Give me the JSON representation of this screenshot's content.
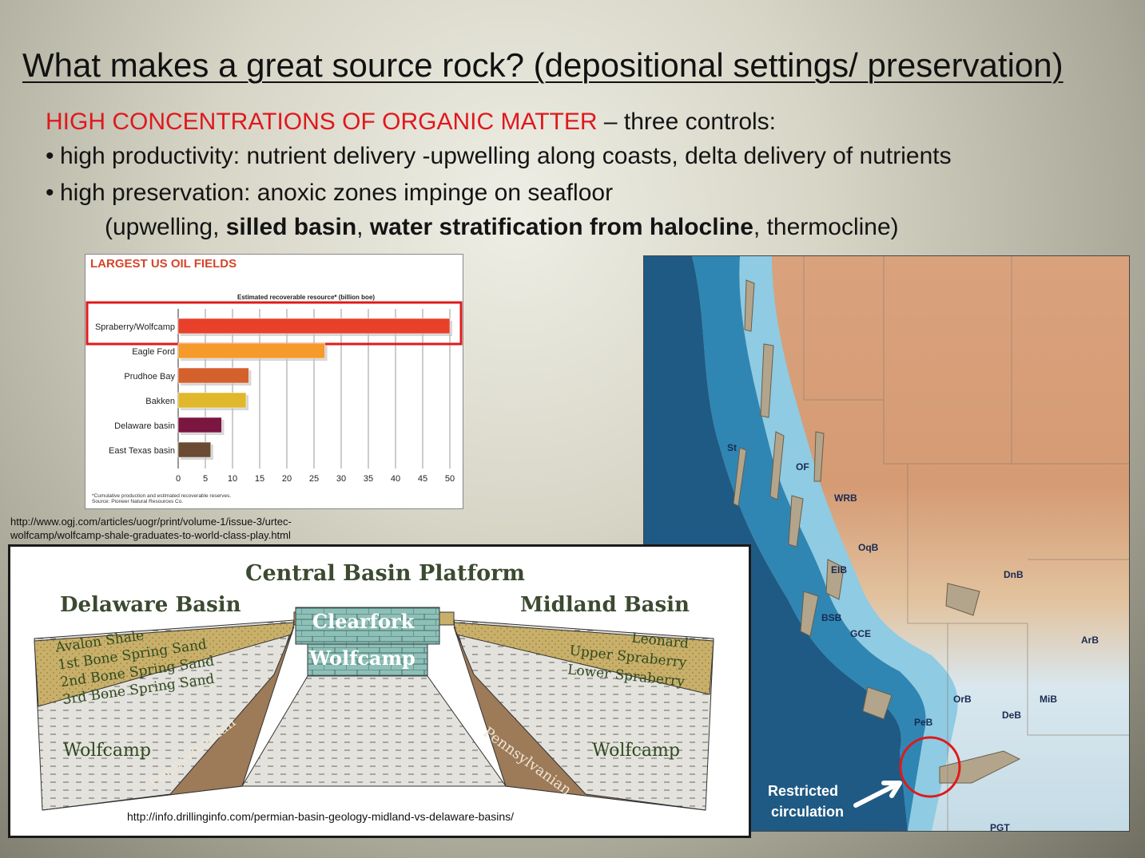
{
  "slide": {
    "title": "What makes a great source rock? (depositional settings/ preservation)",
    "line1_red": "HIGH CONCENTRATIONS OF ORGANIC MATTER",
    "line1_rest": " – three controls:",
    "bullet1": "high productivity: nutrient delivery -upwelling along coasts, delta delivery of nutrients",
    "bullet2": "high preservation: anoxic zones impinge on seafloor",
    "sub_open": "(upwelling, ",
    "sub_b1": "silled basin",
    "sub_comma": ", ",
    "sub_b2": "water stratification from halocline",
    "sub_close": ", thermocline)",
    "bullet_char": "•"
  },
  "chart_data": {
    "type": "bar",
    "title": "LARGEST US OIL FIELDS",
    "xlabel": "Estimated recoverable resource* (billion boe)",
    "categories": [
      "Spraberry/Wolfcamp",
      "Eagle Ford",
      "Prudhoe Bay",
      "Bakken",
      "Delaware basin",
      "East Texas basin"
    ],
    "values": [
      50,
      27,
      13,
      12.5,
      8,
      6
    ],
    "colors": [
      "#e8402a",
      "#f59a2b",
      "#d4612c",
      "#e1b82c",
      "#7a1640",
      "#6a4a32"
    ],
    "xticks": [
      "0",
      "5",
      "10",
      "15",
      "20",
      "25",
      "30",
      "35",
      "40",
      "45",
      "50"
    ],
    "xlim": [
      0,
      50
    ],
    "highlight": "Spraberry/Wolfcamp",
    "note_line1": "*Cumulative production and estimated recoverable reserves.",
    "note_line2": "Source: Pioneer Natural Resources Co."
  },
  "sources": {
    "url1_line1": "http://www.ogj.com/articles/uogr/print/volume-1/issue-3/urtec-",
    "url1_line2": "wolfcamp/wolfcamp-shale-graduates-to-world-class-play.html",
    "url2": "http://info.drillinginfo.com/permian-basin-geology-midland-vs-delaware-basins/"
  },
  "cross_section": {
    "platform": "Central Basin Platform",
    "left_basin": "Delaware Basin",
    "right_basin": "Midland Basin",
    "clearfork": "Clearfork",
    "wolfcamp_center": "Wolfcamp",
    "left_units": [
      "Avalon Shale",
      "1st Bone Spring Sand",
      "2nd Bone Spring Sand",
      "3rd Bone Spring Sand"
    ],
    "right_units": [
      "Leonard",
      "Upper Spraberry",
      "Lower Spraberry"
    ],
    "wolfcamp_left": "Wolfcamp",
    "wolfcamp_right": "Wolfcamp",
    "penn_left": "Pennsylvanian",
    "penn_right": "Pennsylvanian"
  },
  "map": {
    "labels": [
      "St",
      "OF",
      "WRB",
      "OqB",
      "EIB",
      "DnB",
      "BSB",
      "GCE",
      "ArB",
      "OrB",
      "MiB",
      "DeB",
      "PeB",
      "PGT"
    ],
    "callout_line1": "Restricted",
    "callout_line2": "circulation",
    "circle_color": "#e01919"
  }
}
